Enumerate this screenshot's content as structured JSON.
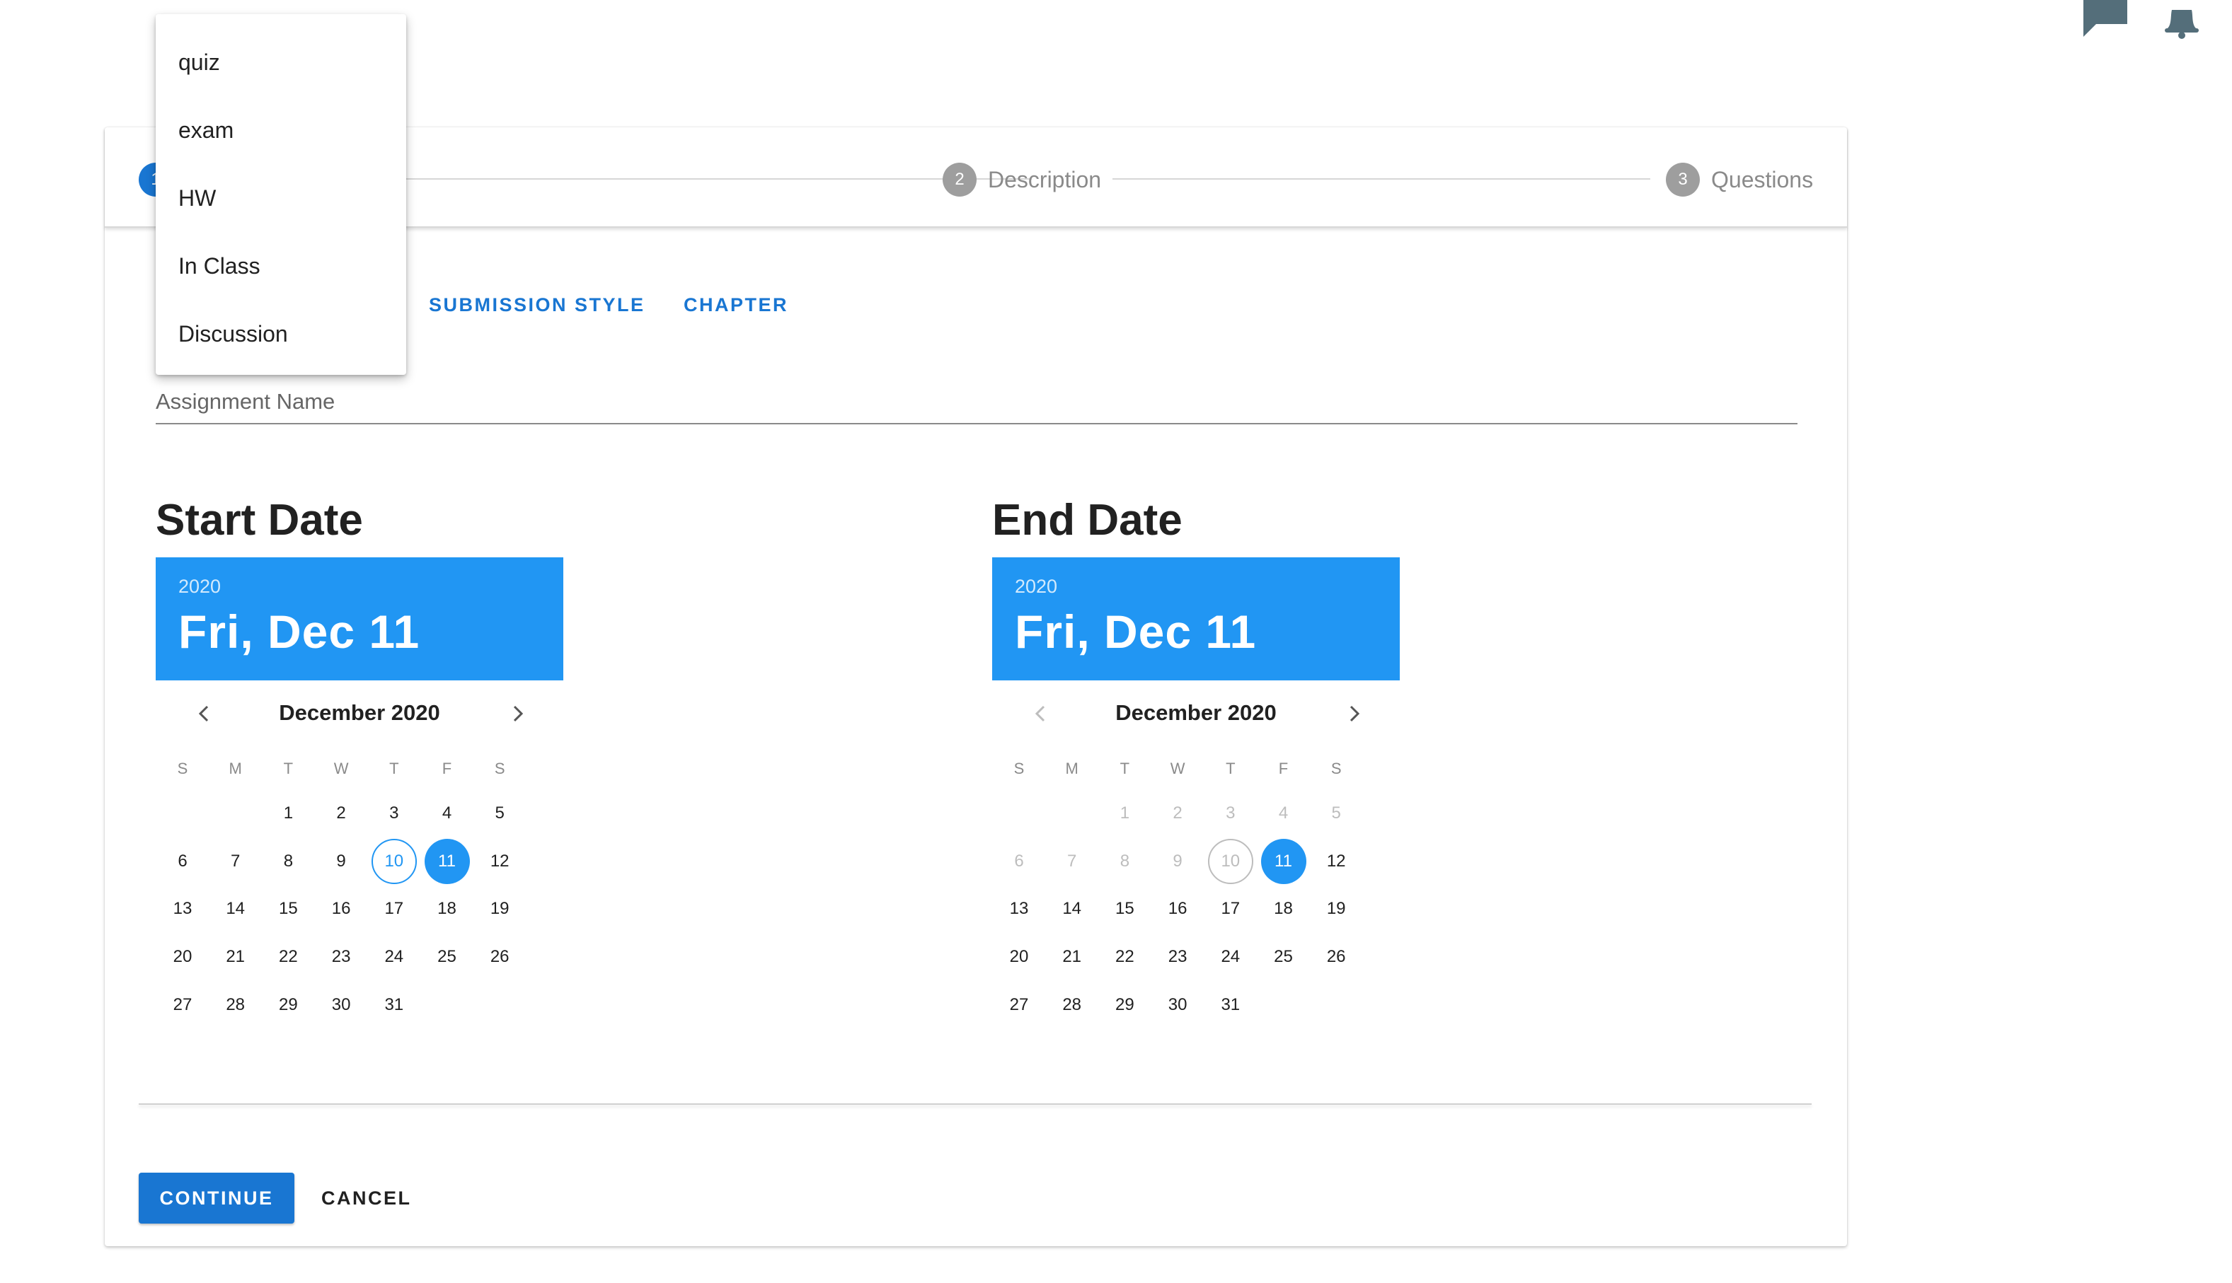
{
  "header_icons": [
    {
      "name": "chat-icon",
      "color": "#546e7a"
    },
    {
      "name": "bell-icon",
      "color": "#546e7a"
    }
  ],
  "stepper": {
    "steps": [
      {
        "number": "1",
        "label": ""
      },
      {
        "number": "2",
        "label": "Description"
      },
      {
        "number": "3",
        "label": "Questions"
      }
    ],
    "active_color": "#1976d2",
    "inactive_color": "#9e9e9e"
  },
  "dropdown": {
    "items": [
      "quiz",
      "exam",
      "HW",
      "In Class",
      "Discussion"
    ]
  },
  "tabs": [
    "SUBMISSION STYLE",
    "CHAPTER"
  ],
  "assignment_name": {
    "label": "Assignment Name",
    "value": ""
  },
  "start_date": {
    "title": "Start Date",
    "year": "2020",
    "selected_display": "Fri, Dec 11",
    "month_label": "December 2020",
    "weekdays": [
      "S",
      "M",
      "T",
      "W",
      "T",
      "F",
      "S"
    ],
    "days": [
      "1",
      "2",
      "3",
      "4",
      "5",
      "6",
      "7",
      "8",
      "9",
      "10",
      "11",
      "12",
      "13",
      "14",
      "15",
      "16",
      "17",
      "18",
      "19",
      "20",
      "21",
      "22",
      "23",
      "24",
      "25",
      "26",
      "27",
      "28",
      "29",
      "30",
      "31"
    ],
    "first_weekday_index": 2,
    "today": "10",
    "selected": "11",
    "disabled_before": 0
  },
  "end_date": {
    "title": "End Date",
    "year": "2020",
    "selected_display": "Fri, Dec 11",
    "month_label": "December 2020",
    "weekdays": [
      "S",
      "M",
      "T",
      "W",
      "T",
      "F",
      "S"
    ],
    "days": [
      "1",
      "2",
      "3",
      "4",
      "5",
      "6",
      "7",
      "8",
      "9",
      "10",
      "11",
      "12",
      "13",
      "14",
      "15",
      "16",
      "17",
      "18",
      "19",
      "20",
      "21",
      "22",
      "23",
      "24",
      "25",
      "26",
      "27",
      "28",
      "29",
      "30",
      "31"
    ],
    "first_weekday_index": 2,
    "today": "10",
    "selected": "11",
    "disabled_before": 11
  },
  "actions": {
    "continue_label": "CONTINUE",
    "cancel_label": "CANCEL"
  },
  "colors": {
    "accent": "#2196f3",
    "primary": "#1976d2"
  }
}
